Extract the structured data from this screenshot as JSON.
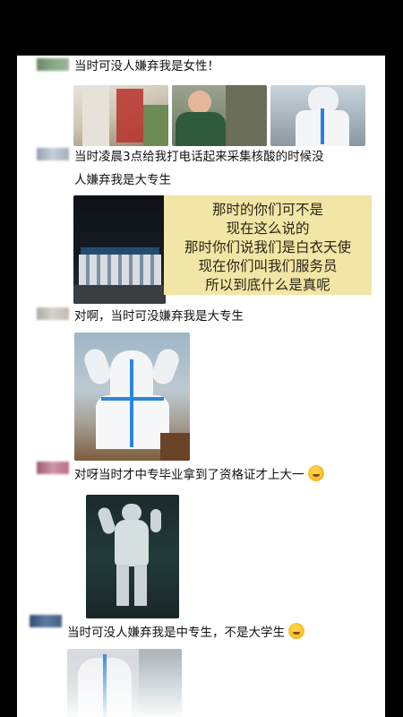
{
  "comments": [
    {
      "text": "当时可没人嫌弃我是女性！",
      "avatar_color": "#6d8a62"
    },
    {
      "text_line1": "当时凌晨3点给我打电话起来采集核酸的时候没",
      "text_line2": "人嫌弃我是大专生",
      "avatar_color": "#9aa6b8"
    },
    {
      "text": "对啊，当时可没嫌弃我是大专生",
      "avatar_color": "#b9b3ad"
    },
    {
      "text": "对呀当时才中专毕业拿到了资格证才上大一",
      "avatar_color": "#b25f7a"
    },
    {
      "text": "当时可没人嫌弃我是中专生，不是大学生",
      "avatar_color": "#2f4f7a"
    }
  ],
  "note": {
    "lines": [
      "那时的你们可不是",
      "现在这么说的",
      "那时你们说我们是白衣天使",
      "现在你们叫我们服务员",
      "所以到底什么是真呢"
    ]
  },
  "colors": {
    "note_bg": "#f2e6a6",
    "screen_bg": "#ffffff"
  }
}
